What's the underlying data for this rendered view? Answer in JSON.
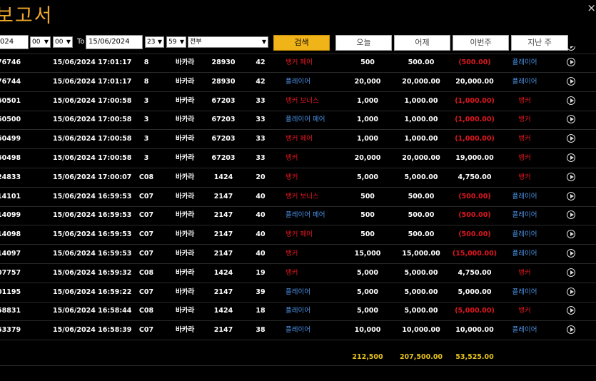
{
  "title": "보고서",
  "close_icon": "×",
  "filters": {
    "from_date": "024",
    "from_hour": "00",
    "from_minute": "00",
    "to_label": "To",
    "to_date": "15/06/2024",
    "to_hour": "23",
    "to_minute": "59",
    "type": "전부",
    "search_label": "검색",
    "today_label": "오늘",
    "yesterday_label": "어제",
    "this_week_label": "이번주",
    "last_week_label": "지난 주"
  },
  "rows": [
    {
      "id": "76746",
      "time": "15/06/2024 17:01:17",
      "table": "8",
      "game": "바카라",
      "round": "28930",
      "no": "42",
      "bet": "뱅커 페어",
      "bet_color": "red",
      "amount": "500",
      "valid": "500.00",
      "win": "(500.00)",
      "win_color": "red",
      "result": "플레이어",
      "result_color": "blue"
    },
    {
      "id": "76744",
      "time": "15/06/2024 17:01:17",
      "table": "8",
      "game": "바카라",
      "round": "28930",
      "no": "42",
      "bet": "플레이어",
      "bet_color": "blue",
      "amount": "20,000",
      "valid": "20,000.00",
      "win": "20,000.00",
      "win_color": "white",
      "result": "플레이어",
      "result_color": "blue"
    },
    {
      "id": "60501",
      "time": "15/06/2024 17:00:58",
      "table": "3",
      "game": "바카라",
      "round": "67203",
      "no": "33",
      "bet": "뱅커 보너스",
      "bet_color": "red",
      "amount": "1,000",
      "valid": "1,000.00",
      "win": "(1,000.00)",
      "win_color": "red",
      "result": "뱅커",
      "result_color": "red"
    },
    {
      "id": "60500",
      "time": "15/06/2024 17:00:58",
      "table": "3",
      "game": "바카라",
      "round": "67203",
      "no": "33",
      "bet": "플레이어 페어",
      "bet_color": "blue",
      "amount": "1,000",
      "valid": "1,000.00",
      "win": "(1,000.00)",
      "win_color": "red",
      "result": "뱅커",
      "result_color": "red"
    },
    {
      "id": "60499",
      "time": "15/06/2024 17:00:58",
      "table": "3",
      "game": "바카라",
      "round": "67203",
      "no": "33",
      "bet": "뱅커 페어",
      "bet_color": "red",
      "amount": "1,000",
      "valid": "1,000.00",
      "win": "(1,000.00)",
      "win_color": "red",
      "result": "뱅커",
      "result_color": "red"
    },
    {
      "id": "60498",
      "time": "15/06/2024 17:00:58",
      "table": "3",
      "game": "바카라",
      "round": "67203",
      "no": "33",
      "bet": "뱅커",
      "bet_color": "red",
      "amount": "20,000",
      "valid": "20,000.00",
      "win": "19,000.00",
      "win_color": "white",
      "result": "뱅커",
      "result_color": "red"
    },
    {
      "id": "24833",
      "time": "15/06/2024 17:00:07",
      "table": "C08",
      "game": "바카라",
      "round": "1424",
      "no": "20",
      "bet": "뱅커",
      "bet_color": "red",
      "amount": "5,000",
      "valid": "5,000.00",
      "win": "4,750.00",
      "win_color": "white",
      "result": "뱅커",
      "result_color": "red"
    },
    {
      "id": "14101",
      "time": "15/06/2024 16:59:53",
      "table": "C07",
      "game": "바카라",
      "round": "2147",
      "no": "40",
      "bet": "뱅커 보너스",
      "bet_color": "red",
      "amount": "500",
      "valid": "500.00",
      "win": "(500.00)",
      "win_color": "red",
      "result": "플레이어",
      "result_color": "blue"
    },
    {
      "id": "14099",
      "time": "15/06/2024 16:59:53",
      "table": "C07",
      "game": "바카라",
      "round": "2147",
      "no": "40",
      "bet": "플레이어 페어",
      "bet_color": "blue",
      "amount": "500",
      "valid": "500.00",
      "win": "(500.00)",
      "win_color": "red",
      "result": "플레이어",
      "result_color": "blue"
    },
    {
      "id": "14098",
      "time": "15/06/2024 16:59:53",
      "table": "C07",
      "game": "바카라",
      "round": "2147",
      "no": "40",
      "bet": "뱅커 페어",
      "bet_color": "red",
      "amount": "500",
      "valid": "500.00",
      "win": "(500.00)",
      "win_color": "red",
      "result": "플레이어",
      "result_color": "blue"
    },
    {
      "id": "14097",
      "time": "15/06/2024 16:59:53",
      "table": "C07",
      "game": "바카라",
      "round": "2147",
      "no": "40",
      "bet": "뱅커",
      "bet_color": "red",
      "amount": "15,000",
      "valid": "15,000.00",
      "win": "(15,000.00)",
      "win_color": "red",
      "result": "플레이어",
      "result_color": "blue"
    },
    {
      "id": "07757",
      "time": "15/06/2024 16:59:32",
      "table": "C08",
      "game": "바카라",
      "round": "1424",
      "no": "19",
      "bet": "뱅커",
      "bet_color": "red",
      "amount": "5,000",
      "valid": "5,000.00",
      "win": "4,750.00",
      "win_color": "white",
      "result": "뱅커",
      "result_color": "red"
    },
    {
      "id": "01195",
      "time": "15/06/2024 16:59:22",
      "table": "C07",
      "game": "바카라",
      "round": "2147",
      "no": "39",
      "bet": "플레이어",
      "bet_color": "blue",
      "amount": "5,000",
      "valid": "5,000.00",
      "win": "5,000.00",
      "win_color": "white",
      "result": "플레이어",
      "result_color": "blue"
    },
    {
      "id": "58831",
      "time": "15/06/2024 16:58:44",
      "table": "C08",
      "game": "바카라",
      "round": "1424",
      "no": "18",
      "bet": "플레이어",
      "bet_color": "blue",
      "amount": "5,000",
      "valid": "5,000.00",
      "win": "(5,000.00)",
      "win_color": "red",
      "result": "뱅커",
      "result_color": "red"
    },
    {
      "id": "53379",
      "time": "15/06/2024 16:58:39",
      "table": "C07",
      "game": "바카라",
      "round": "2147",
      "no": "38",
      "bet": "플레이어",
      "bet_color": "blue",
      "amount": "10,000",
      "valid": "10,000.00",
      "win": "10,000.00",
      "win_color": "white",
      "result": "플레이어",
      "result_color": "blue"
    }
  ],
  "totals": {
    "amount": "212,500",
    "valid": "207,500.00",
    "win": "53,525.00"
  },
  "colors": {
    "title": "#f0a82a",
    "search_button": "#f0b419",
    "loss_red": "#e0161e",
    "player_blue": "#4a90e2",
    "totals_yellow": "#e6c21a"
  },
  "icons": {
    "play": "play-circle-icon",
    "close": "close-icon",
    "dropdown": "chevron-down-icon"
  }
}
